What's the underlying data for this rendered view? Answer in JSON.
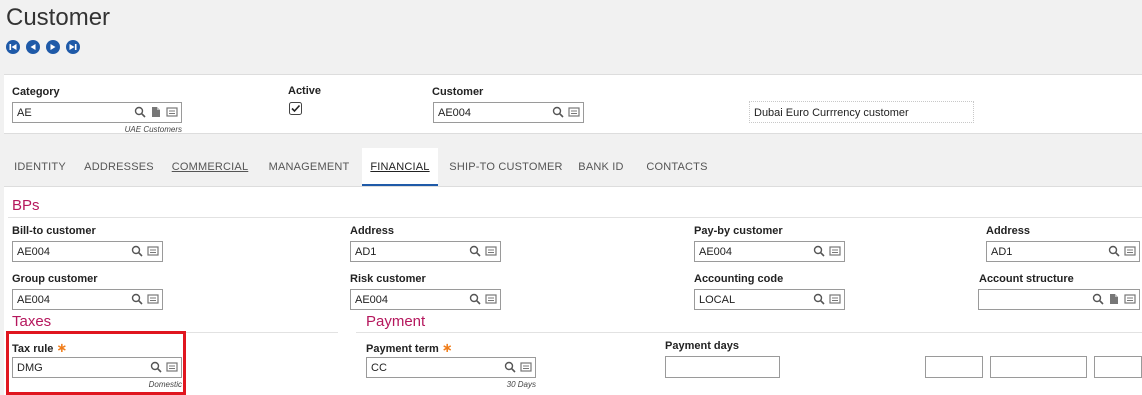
{
  "page": {
    "title": "Customer"
  },
  "header": {
    "category": {
      "label": "Category",
      "value": "AE",
      "sub": "UAE Customers"
    },
    "active": {
      "label": "Active",
      "checked": true
    },
    "customer": {
      "label": "Customer",
      "value": "AE004",
      "description": "Dubai Euro Currrency customer"
    }
  },
  "tabs": [
    {
      "label": "IDENTITY"
    },
    {
      "label": "ADDRESSES"
    },
    {
      "label": "COMMERCIAL"
    },
    {
      "label": "MANAGEMENT"
    },
    {
      "label": "FINANCIAL",
      "active": true
    },
    {
      "label": "SHIP-TO CUSTOMER"
    },
    {
      "label": "BANK ID"
    },
    {
      "label": "CONTACTS"
    }
  ],
  "bps": {
    "title": "BPs",
    "bill_to": {
      "label": "Bill-to customer",
      "value": "AE004"
    },
    "address1": {
      "label": "Address",
      "value": "AD1"
    },
    "pay_by": {
      "label": "Pay-by customer",
      "value": "AE004"
    },
    "address2": {
      "label": "Address",
      "value": "AD1"
    },
    "group": {
      "label": "Group customer",
      "value": "AE004"
    },
    "risk": {
      "label": "Risk customer",
      "value": "AE004"
    },
    "accounting_code": {
      "label": "Accounting code",
      "value": "LOCAL"
    },
    "account_structure": {
      "label": "Account structure",
      "value": ""
    }
  },
  "taxes": {
    "title": "Taxes",
    "tax_rule": {
      "label": "Tax rule",
      "value": "DMG",
      "sub": "Domestic"
    }
  },
  "payment": {
    "title": "Payment",
    "payment_term": {
      "label": "Payment term",
      "value": "CC",
      "sub": "30 Days"
    },
    "payment_days": {
      "label": "Payment days"
    }
  },
  "colors": {
    "accent": "#1f5aa8",
    "section": "#b5175d",
    "required": "#f07d1a",
    "highlight": "#e0161f"
  }
}
